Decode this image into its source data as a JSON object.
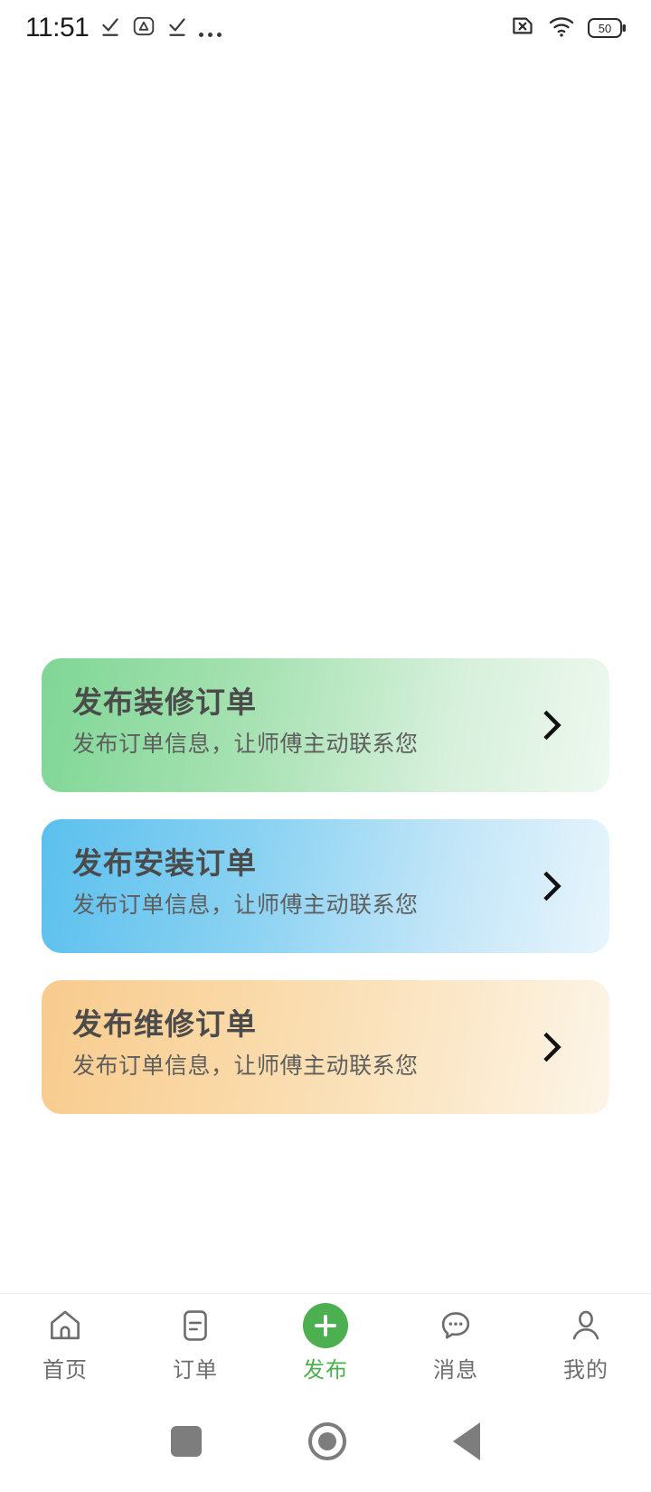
{
  "status_bar": {
    "time": "11:51",
    "left_icons": [
      "download-done-icon",
      "triangle-alert-icon",
      "download-done-icon",
      "more-dots-icon"
    ],
    "right_icons": [
      "sim-card-off-icon",
      "wifi-icon",
      "battery-icon"
    ],
    "battery_level": "50"
  },
  "cards": [
    {
      "id": "decoration",
      "title": "发布装修订单",
      "subtitle": "发布订单信息，让师傅主动联系您",
      "color_start": "#7fd695",
      "color_end": "#eef8ef",
      "arrow_icon": "chevron-right-icon"
    },
    {
      "id": "installation",
      "title": "发布安装订单",
      "subtitle": "发布订单信息，让师傅主动联系您",
      "color_start": "#5bc0ee",
      "color_end": "#e8f5fc",
      "arrow_icon": "chevron-right-icon"
    },
    {
      "id": "repair",
      "title": "发布维修订单",
      "subtitle": "发布订单信息，让师傅主动联系您",
      "color_start": "#f8cb8e",
      "color_end": "#fdf5e8",
      "arrow_icon": "chevron-right-icon"
    }
  ],
  "tab_bar": {
    "active_color": "#4caf50",
    "inactive_color": "#6d6d6d",
    "items": [
      {
        "label": "首页",
        "icon": "home-icon",
        "active": false
      },
      {
        "label": "订单",
        "icon": "document-icon",
        "active": false
      },
      {
        "label": "发布",
        "icon": "plus-circle-icon",
        "active": true
      },
      {
        "label": "消息",
        "icon": "chat-bubble-icon",
        "active": false
      },
      {
        "label": "我的",
        "icon": "person-icon",
        "active": false
      }
    ]
  },
  "android_nav": {
    "items": [
      {
        "name": "recents-button",
        "icon": "square-icon"
      },
      {
        "name": "home-button",
        "icon": "circle-icon"
      },
      {
        "name": "back-button",
        "icon": "triangle-left-icon"
      }
    ]
  }
}
